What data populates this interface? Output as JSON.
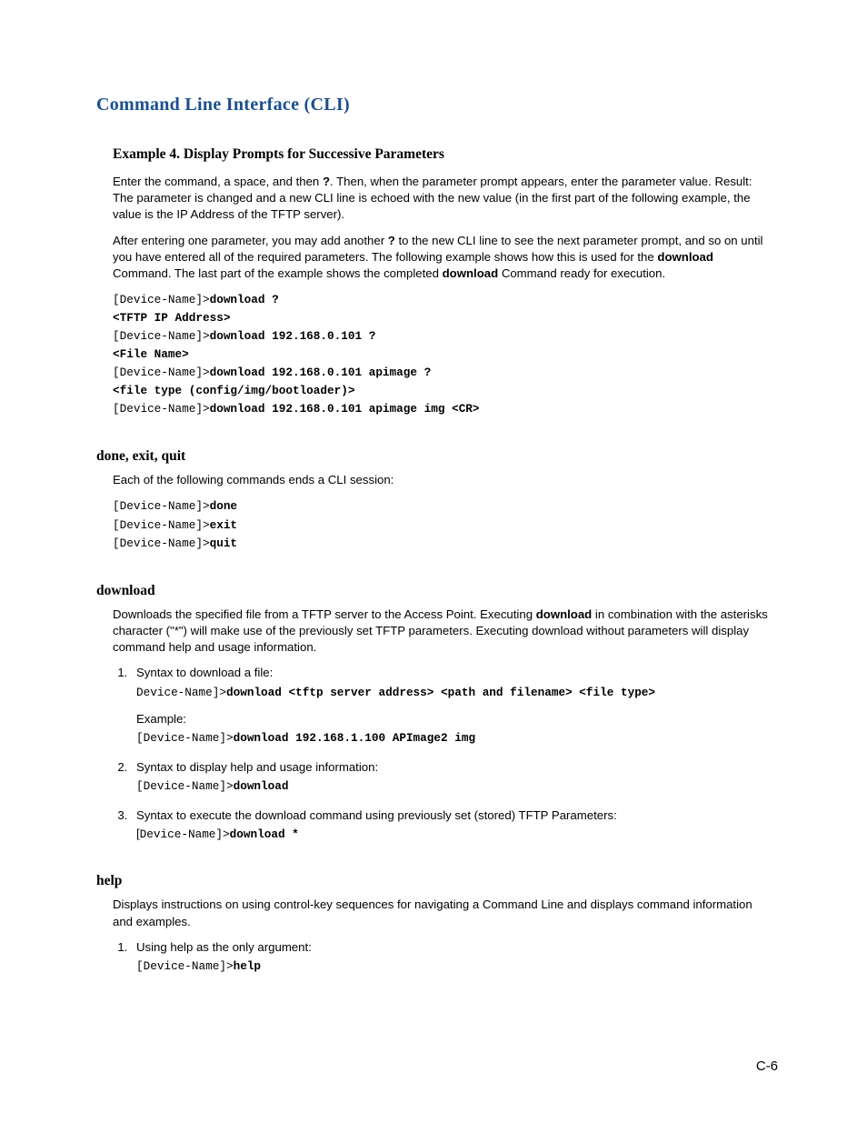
{
  "title": "Command Line Interface (CLI)",
  "example4": {
    "heading": "Example 4. Display Prompts for Successive Parameters",
    "p1_a": "Enter the command, a space, and then ",
    "p1_q": "?",
    "p1_b": ". Then, when the parameter prompt appears, enter the parameter value. Result: The parameter is changed and a new CLI line is echoed with the new value (in the first part of the following example, the value is the IP Address of the TFTP server).",
    "p2_a": "After entering one parameter, you may add another ",
    "p2_q": "?",
    "p2_b": " to the new CLI line to see the next parameter prompt, and so on until you have entered all of the required parameters. The following example shows how this is used for the ",
    "p2_dl": "download",
    "p2_c": " Command. The last part of the example shows the completed ",
    "p2_dl2": "download",
    "p2_d": " Command ready for execution.",
    "prompt": "[Device-Name]>",
    "l1b": "download ?",
    "l2": "<TFTP IP Address>",
    "l3b": "download 192.168.0.101 ?",
    "l4": "<File Name>",
    "l5b": "download 192.168.0.101 apimage ?",
    "l6": "<file type (config/img/bootloader)>",
    "l7b": "download 192.168.0.101 apimage img <CR>"
  },
  "done": {
    "heading": "done, exit, quit",
    "p1": "Each of the following commands ends a CLI session:",
    "prompt": "[Device-Name]>",
    "c1": "done",
    "c2": "exit",
    "c3": "quit"
  },
  "download": {
    "heading": "download",
    "p1_a": "Downloads the specified file from a TFTP server to the Access Point. Executing ",
    "p1_b": "download",
    "p1_c": " in combination with the asterisks character (\"*\") will make use of the previously set TFTP parameters. Executing download without parameters will display command help and usage information.",
    "li1_text": "Syntax to download a file:",
    "li1_prompt": "Device-Name]>",
    "li1_cmd": "download <tftp server address> <path and filename> <file type>",
    "li1_ex_label": "Example:",
    "li1_ex_prompt": "[Device-Name]>",
    "li1_ex_cmd": "download 192.168.1.100 APImage2 img",
    "li2_text": "Syntax to display help and usage information:",
    "li2_prompt": "[Device-Name]>",
    "li2_cmd": "download",
    "li3_text": " Syntax to execute the download command using previously set (stored) TFTP Parameters:",
    "li3_prompt": "Device-Name]>",
    "li3_openbracket": "[",
    "li3_cmd": "download *"
  },
  "help": {
    "heading": "help",
    "p1": "Displays instructions on using control-key sequences for navigating a Command Line and displays command information and examples.",
    "li1_text": "Using help as the only argument:",
    "li1_prompt": "[Device-Name]>",
    "li1_cmd": "help"
  },
  "pagenum": "C-6"
}
